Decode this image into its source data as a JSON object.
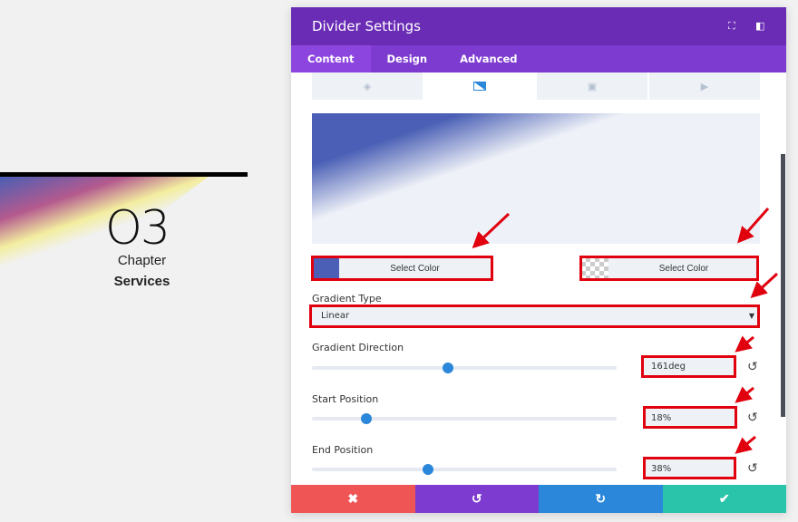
{
  "preview": {
    "number": "O3",
    "chapter": "Chapter",
    "title": "Services"
  },
  "panel": {
    "title": "Divider Settings",
    "header_icons": [
      "fullscreen-icon",
      "sidebar-toggle-icon"
    ],
    "tabs": [
      {
        "label": "Content"
      },
      {
        "label": "Design"
      },
      {
        "label": "Advanced"
      }
    ],
    "active_tab": "Content",
    "background_tabs": [
      "color-fill-icon",
      "gradient-icon",
      "image-icon",
      "video-icon"
    ],
    "gradient": {
      "start_color": {
        "label": "Select Color",
        "swatch": "#4a5fb5"
      },
      "end_color": {
        "label": "Select Color",
        "swatch": "transparent"
      },
      "type_label": "Gradient Type",
      "type_value": "Linear",
      "direction": {
        "label": "Gradient Direction",
        "value": "161deg",
        "fraction": 0.447
      },
      "start": {
        "label": "Start Position",
        "value": "18%",
        "fraction": 0.18
      },
      "end": {
        "label": "End Position",
        "value": "38%",
        "fraction": 0.38
      }
    },
    "footer": {
      "cancel": "✖",
      "undo": "↺",
      "redo": "↻",
      "save": "✔"
    },
    "colors": {
      "header": "#6a2cb5",
      "tabs": "#7d3bd0",
      "cancel": "#ef5555",
      "undo": "#7e3bd0",
      "redo": "#2b87da",
      "save": "#29c4a9",
      "annotation": "#e0000e"
    }
  }
}
